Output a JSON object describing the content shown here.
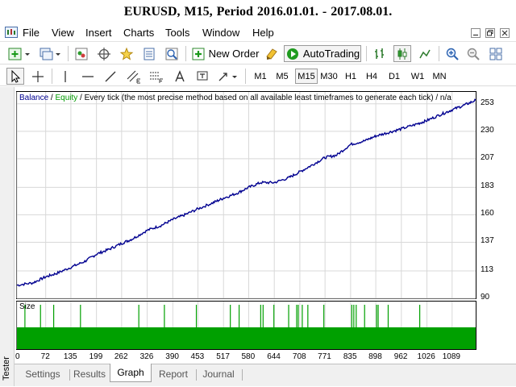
{
  "window": {
    "title": "EURUSD,   M15,   Period  2016.01.01.  -  2017.08.01."
  },
  "menu": [
    "File",
    "View",
    "Insert",
    "Charts",
    "Tools",
    "Window",
    "Help"
  ],
  "toolbar": {
    "new_order_label": "New Order",
    "autotrading_label": "AutoTrading"
  },
  "timeframes": [
    "M1",
    "M5",
    "M15",
    "M30",
    "H1",
    "H4",
    "D1",
    "W1",
    "MN"
  ],
  "active_timeframe": "M15",
  "chart": {
    "legend_balance": "Balance",
    "legend_equity": "Equity",
    "legend_rest": " / Every tick (the most precise method based on all available least timeframes to generate each tick) / n/a",
    "size_label": "Size"
  },
  "tester_label": "Tester",
  "tabs": [
    "Settings",
    "Results",
    "Graph",
    "Report",
    "Journal"
  ],
  "active_tab": "Graph",
  "colors": {
    "balance": "#000090",
    "equity": "#009a00",
    "size_bars": "#00a000"
  },
  "chart_data": {
    "type": "line",
    "title": "",
    "legend": [
      "Balance",
      "Equity"
    ],
    "y_ticks": [
      253,
      230,
      207,
      183,
      160,
      137,
      113,
      90
    ],
    "ylim": [
      90,
      263
    ],
    "x_ticks": [
      0,
      72,
      135,
      199,
      262,
      326,
      390,
      453,
      517,
      580,
      644,
      708,
      771,
      835,
      898,
      962,
      1026,
      1089
    ],
    "xlim": [
      0,
      1148
    ],
    "series": [
      {
        "name": "Balance",
        "x": [
          0,
          40,
          72,
          100,
          135,
          170,
          199,
          230,
          262,
          290,
          326,
          360,
          390,
          420,
          453,
          490,
          517,
          550,
          580,
          610,
          644,
          680,
          708,
          740,
          771,
          800,
          835,
          870,
          898,
          930,
          962,
          1000,
          1026,
          1060,
          1089,
          1120,
          1148
        ],
        "y": [
          101,
          103,
          108,
          111,
          116,
          121,
          127,
          131,
          136,
          140,
          147,
          151,
          156,
          160,
          165,
          170,
          174,
          178,
          183,
          187,
          187,
          191,
          196,
          202,
          208,
          210,
          219,
          222,
          226,
          229,
          232,
          236,
          239,
          244,
          248,
          252,
          256
        ]
      }
    ],
    "size_pane": {
      "type": "bar",
      "base_level": 1,
      "spike_x": [
        20,
        59,
        92,
        159,
        305,
        369,
        449,
        534,
        556,
        610,
        616,
        643,
        680,
        700,
        704,
        714,
        728,
        768,
        838,
        843,
        849,
        870,
        900,
        904,
        929,
        1008
      ]
    }
  }
}
